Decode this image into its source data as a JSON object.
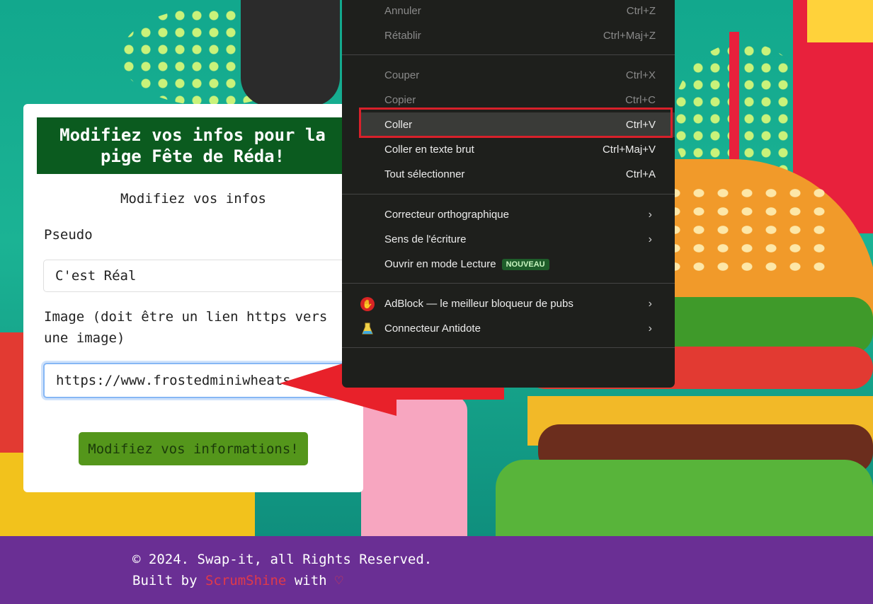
{
  "form": {
    "title": "Modifiez vos infos pour la pige Fête de Réda!",
    "subtitle": "Modifiez vos infos",
    "pseudo_label": "Pseudo",
    "pseudo_value": "C'est Réal",
    "image_label": "Image (doit être un lien https vers une image)",
    "image_value": "https://www.frostedminiwheats",
    "submit_label": "Modifiez vos informations!"
  },
  "context_menu": {
    "groups": [
      [
        {
          "label": "Annuler",
          "shortcut": "Ctrl+Z",
          "disabled": true
        },
        {
          "label": "Rétablir",
          "shortcut": "Ctrl+Maj+Z",
          "disabled": true
        }
      ],
      [
        {
          "label": "Couper",
          "shortcut": "Ctrl+X",
          "disabled": true
        },
        {
          "label": "Copier",
          "shortcut": "Ctrl+C",
          "disabled": true
        },
        {
          "label": "Coller",
          "shortcut": "Ctrl+V",
          "disabled": false,
          "highlighted": true
        },
        {
          "label": "Coller en texte brut",
          "shortcut": "Ctrl+Maj+V",
          "disabled": false
        },
        {
          "label": "Tout sélectionner",
          "shortcut": "Ctrl+A",
          "disabled": false
        }
      ],
      [
        {
          "label": "Correcteur orthographique",
          "submenu": true
        },
        {
          "label": "Sens de l'écriture",
          "submenu": true
        },
        {
          "label": "Ouvrir en mode Lecture",
          "badge": "NOUVEAU"
        }
      ],
      [
        {
          "label": "AdBlock — le meilleur bloqueur de pubs",
          "icon": "adblock-hand-icon",
          "submenu": true
        },
        {
          "label": "Connecteur Antidote",
          "icon": "antidote-flask-icon",
          "submenu": true
        }
      ]
    ],
    "submenu_glyph": "›"
  },
  "footer": {
    "copyright": "© 2024. Swap-it, all Rights Reserved.",
    "built_by": "Built by",
    "brand": "ScrumShine",
    "with": "with",
    "heart": "♡"
  },
  "colors": {
    "header_green": "#0b5b1f",
    "submit_green": "#54961b",
    "footer_purple": "#6a2f94",
    "menu_bg": "#1e1f1c",
    "annotation_red": "#d8202a",
    "brand_red": "#e03a4a"
  }
}
